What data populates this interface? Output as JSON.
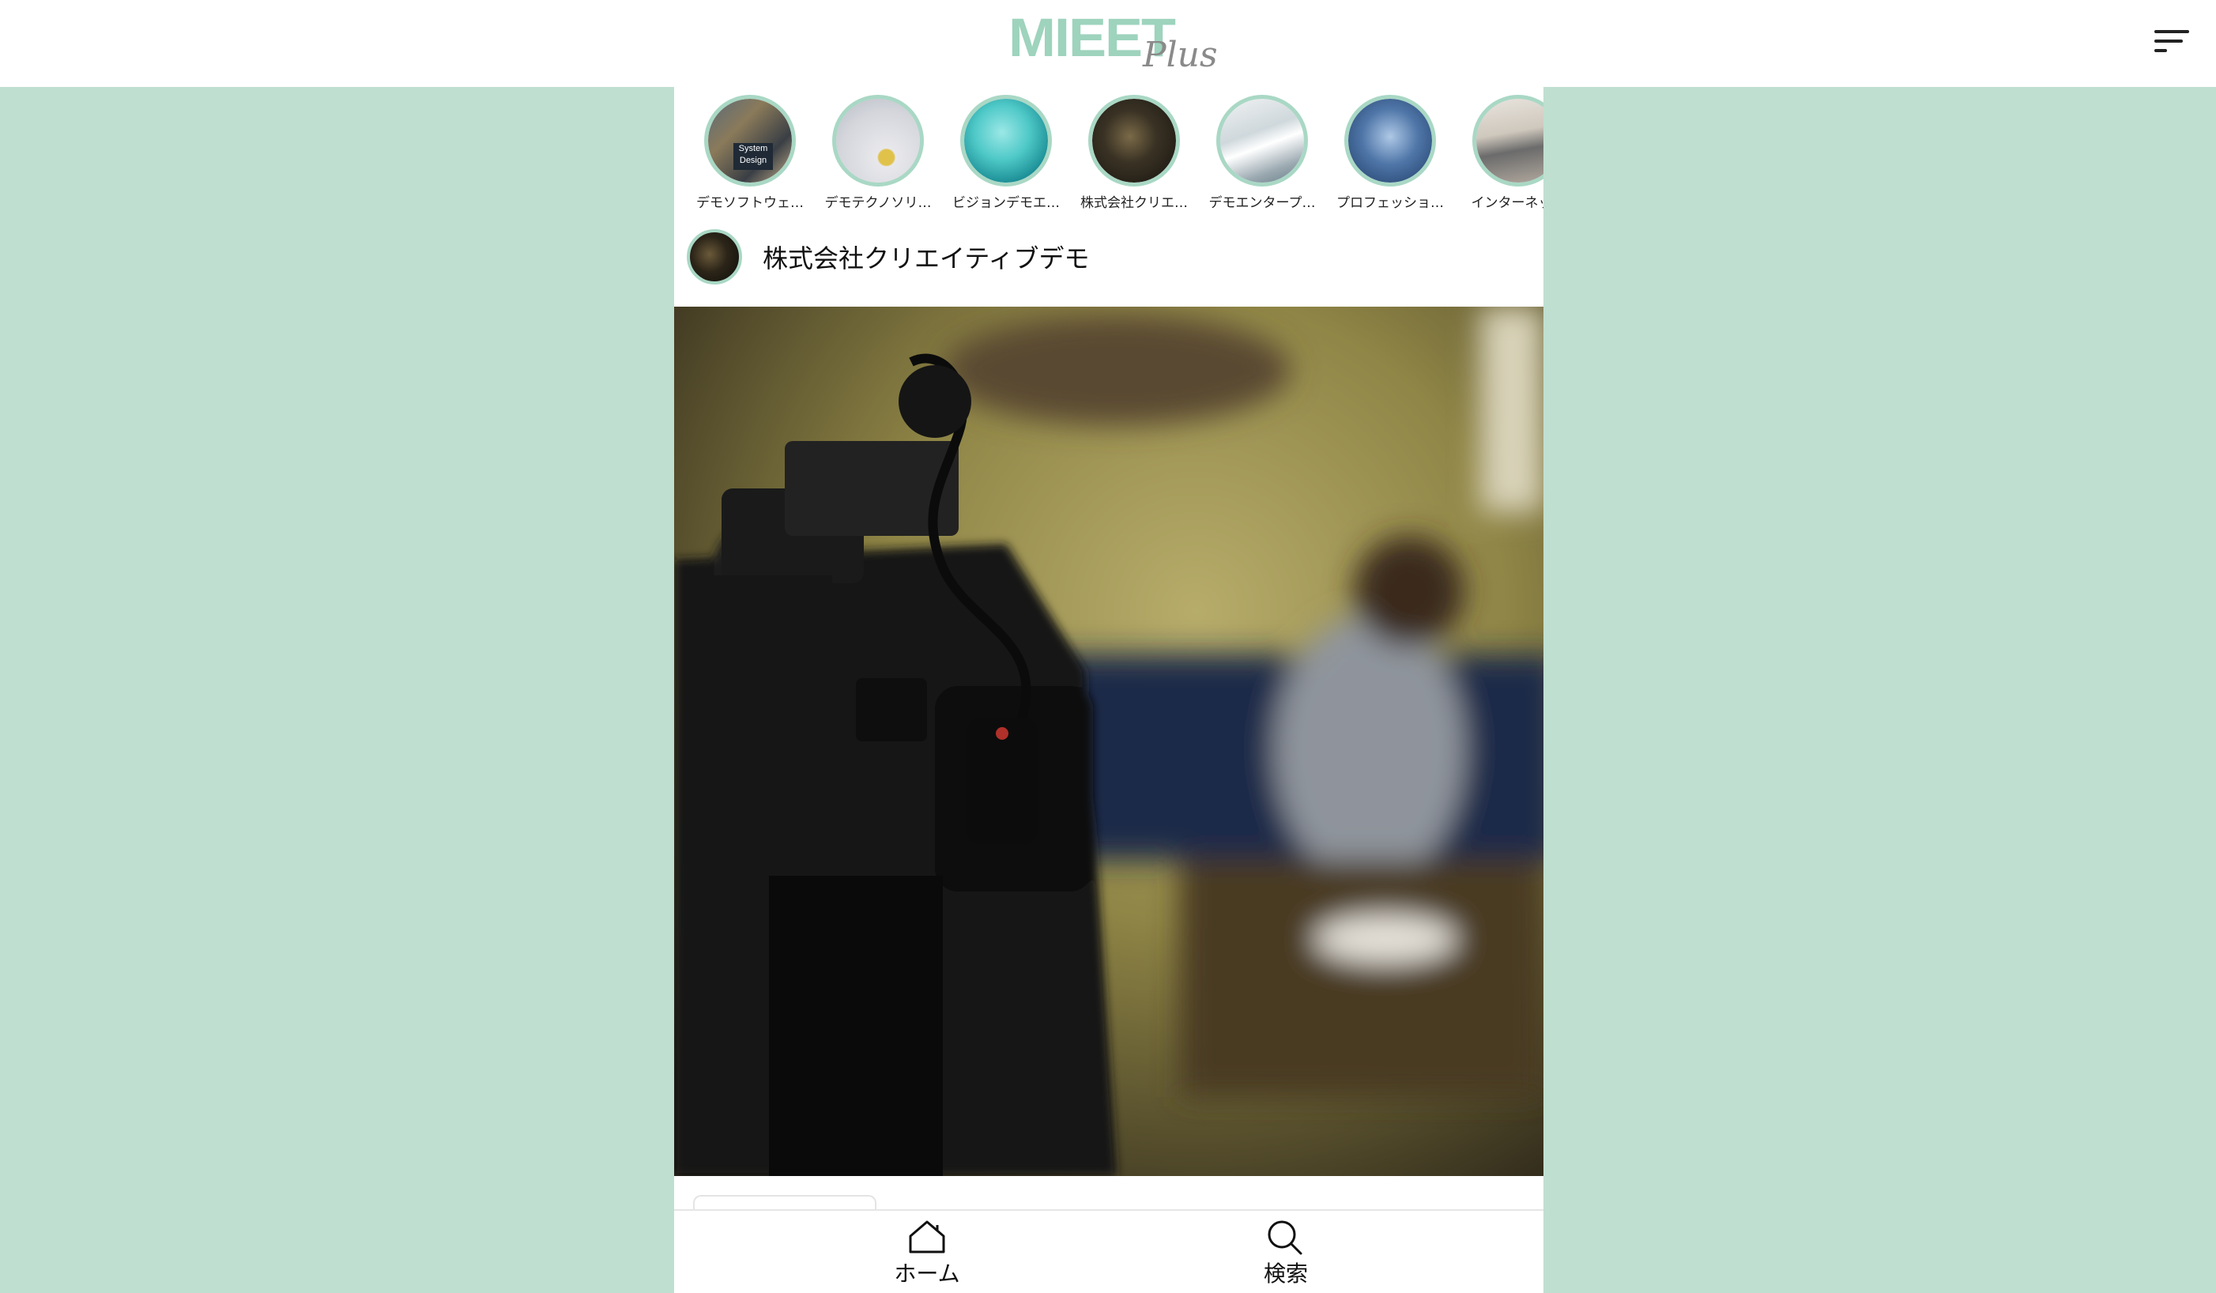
{
  "header": {
    "logo_main": "MIEET",
    "logo_sub": "Plus",
    "menu_icon": "hamburger-menu-icon"
  },
  "stories": [
    {
      "label": "デモソフトウェ…",
      "thumb_text": "System\nDesign"
    },
    {
      "label": "デモテクノソリ…"
    },
    {
      "label": "ビジョンデモエ…"
    },
    {
      "label": "株式会社クリエ…"
    },
    {
      "label": "デモエンタープ…"
    },
    {
      "label": "プロフェッショ…"
    },
    {
      "label": "インターネット"
    }
  ],
  "post": {
    "company_name": "株式会社クリエイティブデモ"
  },
  "bottom_nav": {
    "home_label": "ホーム",
    "search_label": "検索"
  },
  "colors": {
    "background": "#bfdfd0",
    "accent_ring": "#a9d8c5",
    "logo": "#9ed3bd"
  }
}
